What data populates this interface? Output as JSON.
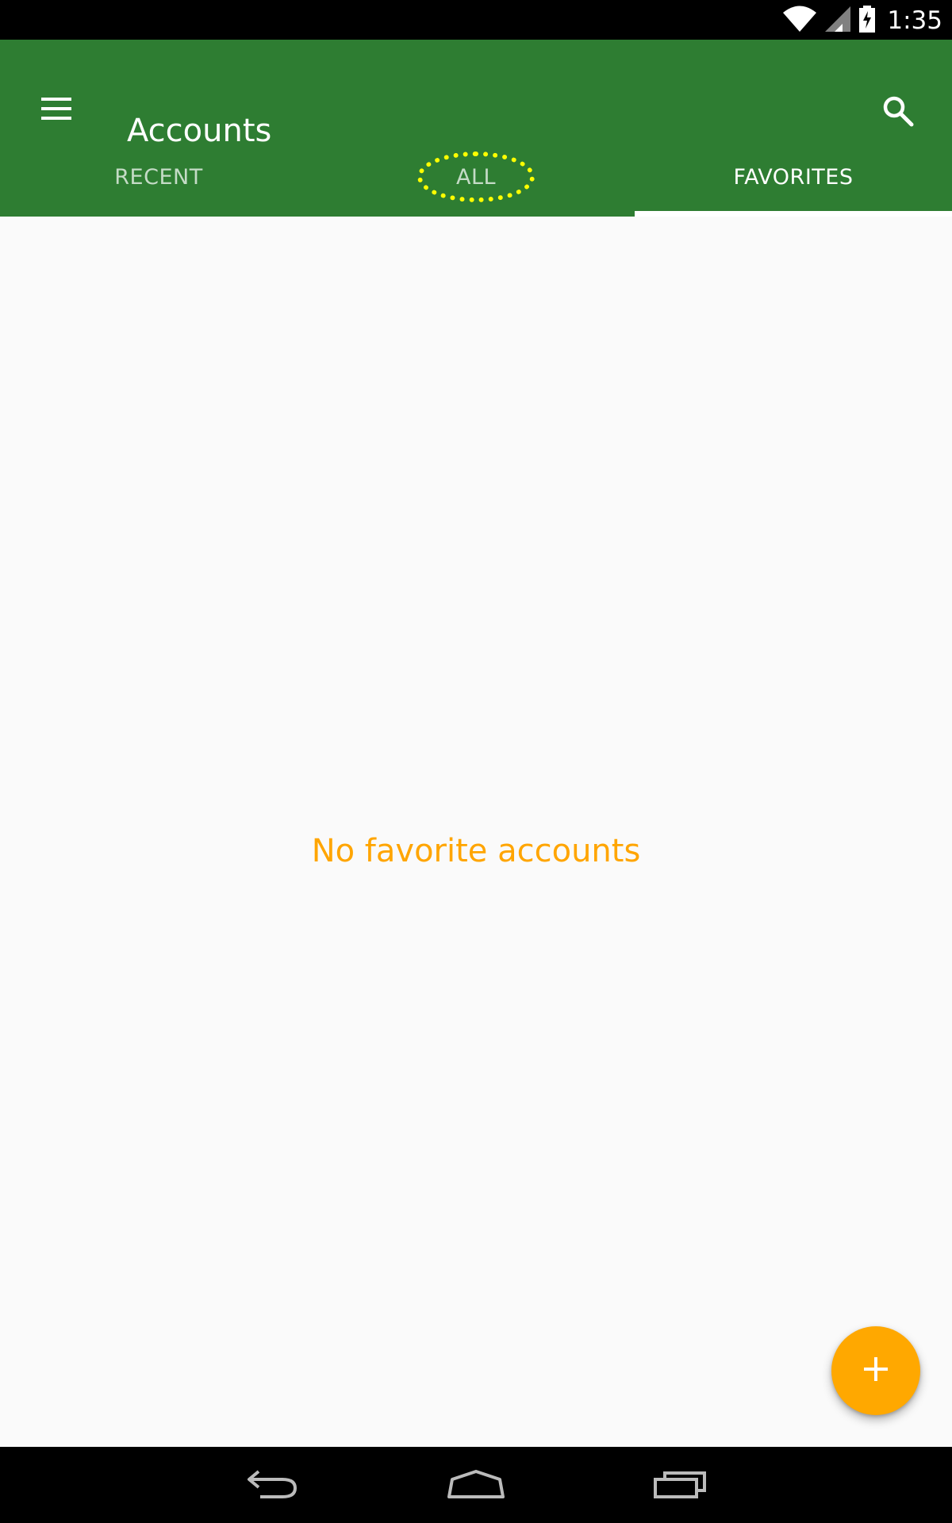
{
  "status_bar": {
    "time": "1:35",
    "icons": [
      "wifi-icon",
      "signal-icon",
      "battery-charging-icon"
    ]
  },
  "app_bar": {
    "title": "Accounts",
    "menu_icon": "menu-icon",
    "search_icon": "search-icon",
    "background_color": "#2e7d32"
  },
  "tabs": [
    {
      "label": "RECENT",
      "active": false
    },
    {
      "label": "ALL",
      "active": false
    },
    {
      "label": "FAVORITES",
      "active": true
    }
  ],
  "main": {
    "empty_message": "No favorite accounts",
    "message_color": "#ffa500"
  },
  "fab": {
    "icon": "plus-icon",
    "color": "#ffa800"
  },
  "nav_bar": {
    "icons": [
      "back-icon",
      "home-icon",
      "recents-icon"
    ]
  }
}
